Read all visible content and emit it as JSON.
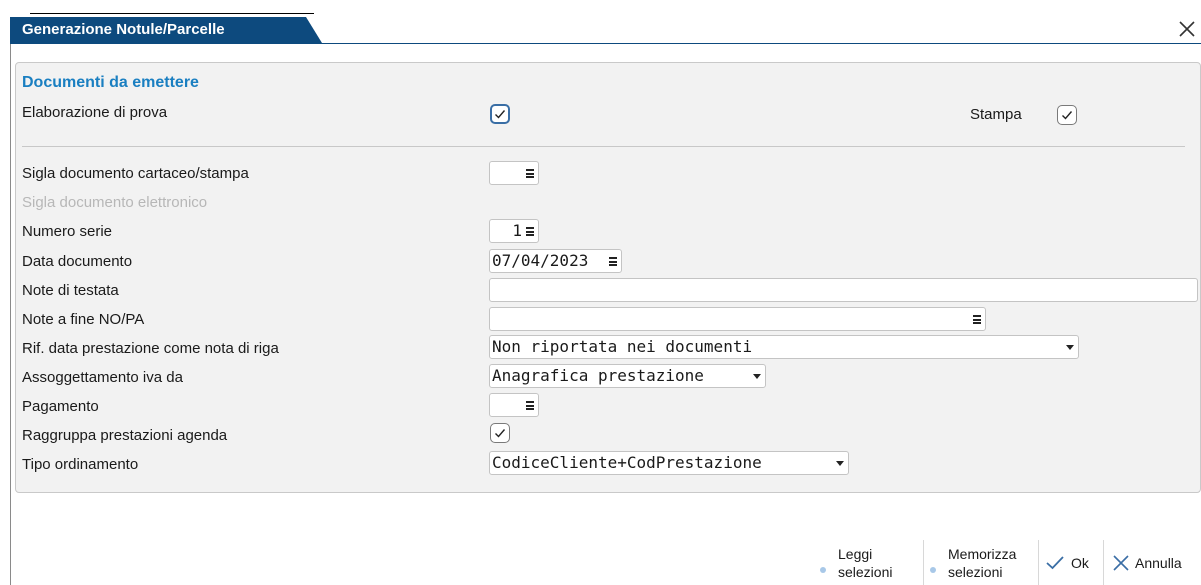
{
  "window": {
    "title": "Generazione Notule/Parcelle"
  },
  "section": {
    "title": "Documenti da emettere"
  },
  "options": {
    "elaborazione_label": "Elaborazione di prova",
    "elaborazione_checked": true,
    "stampa_label": "Stampa",
    "stampa_checked": true
  },
  "fields": {
    "sigla_cartaceo": {
      "label": "Sigla documento cartaceo/stampa",
      "value": ""
    },
    "sigla_elettronico": {
      "label": "Sigla documento elettronico",
      "disabled": true
    },
    "numero_serie": {
      "label": "Numero serie",
      "value": "1"
    },
    "data_documento": {
      "label": "Data documento",
      "value": "07/04/2023"
    },
    "note_testata": {
      "label": "Note di testata",
      "value": ""
    },
    "note_fine": {
      "label": "Note a fine NO/PA",
      "value": ""
    },
    "rif_data": {
      "label": "Rif. data prestazione come nota di riga",
      "value": "Non riportata nei documenti"
    },
    "assoggettamento": {
      "label": "Assoggettamento iva da",
      "value": "Anagrafica prestazione"
    },
    "pagamento": {
      "label": "Pagamento",
      "value": ""
    },
    "raggruppa": {
      "label": "Raggruppa prestazioni agenda",
      "checked": true
    },
    "tipo_ordinamento": {
      "label": "Tipo ordinamento",
      "value": "CodiceCliente+CodPrestazione"
    }
  },
  "footer": {
    "leggi_line1": "Leggi",
    "leggi_line2": "selezioni",
    "memorizza_line1": "Memorizza",
    "memorizza_line2": "selezioni",
    "ok_label": "Ok",
    "annulla_label": "Annulla"
  },
  "colors": {
    "titlebar": "#0d4a7e",
    "section_title": "#1a7fc1",
    "panel_bg": "#f2f2f2"
  },
  "icons": [
    "close-icon",
    "check-icon",
    "menu-icon",
    "caret-down-icon",
    "dot-icon",
    "checkmark-icon",
    "x-icon"
  ]
}
